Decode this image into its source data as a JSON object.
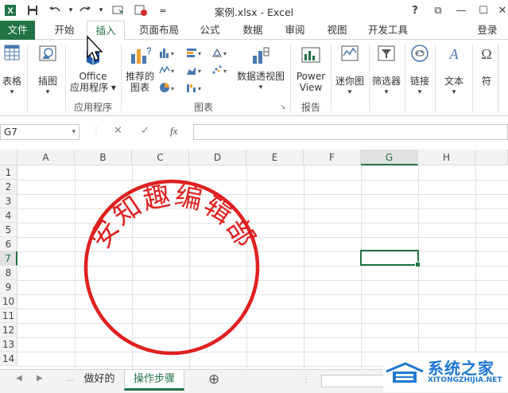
{
  "window": {
    "title": "案例.xlsx - Excel",
    "help": "?",
    "restore_ribbon": "⧉",
    "minimize": "—",
    "maximize": "☐",
    "close": "✕"
  },
  "quick_access": {
    "save_icon": "save-icon",
    "undo_icon": "undo-icon",
    "redo_icon": "redo-icon",
    "customize": "="
  },
  "tabs": [
    "文件",
    "开始",
    "插入",
    "页面布局",
    "公式",
    "数据",
    "审阅",
    "视图",
    "开发工具"
  ],
  "active_tab": "插入",
  "signin": "登录",
  "ribbon": {
    "table": "表格",
    "illustrations": "插图",
    "office_apps_line1": "Office",
    "office_apps_line2": "应用程序 ▾",
    "group_apps": "应用程序",
    "recommended_charts_line1": "推荐的",
    "recommended_charts_line2": "图表",
    "pivot_chart": "数据透视图",
    "group_charts": "图表",
    "power_view_line1": "Power",
    "power_view_line2": "View",
    "group_reports": "报告",
    "sparklines": "迷你图",
    "filters": "筛选器",
    "links": "链接",
    "text": "文本",
    "symbols": "符"
  },
  "formula_bar": {
    "name_box": "G7",
    "cancel": "✕",
    "enter": "✓",
    "fx": "fx",
    "formula": ""
  },
  "grid": {
    "columns": [
      "A",
      "B",
      "C",
      "D",
      "E",
      "F",
      "G",
      "H"
    ],
    "selected_column": "G",
    "rows": [
      "1",
      "2",
      "3",
      "4",
      "5",
      "6",
      "7",
      "8",
      "9",
      "10",
      "11",
      "12",
      "13",
      "14"
    ],
    "selected_row": "7",
    "selected_cell": "G7"
  },
  "stamp": {
    "text": "安知趣编辑部",
    "color": "#e02020"
  },
  "sheets": [
    "做好的",
    "操作步骤"
  ],
  "active_sheet": "操作步骤",
  "add_sheet": "⊕",
  "watermark": {
    "name": "系统之家",
    "url": "XITONGZHIJIA.NET"
  },
  "colors": {
    "excel_green": "#217346",
    "stamp_red": "#e02020"
  }
}
